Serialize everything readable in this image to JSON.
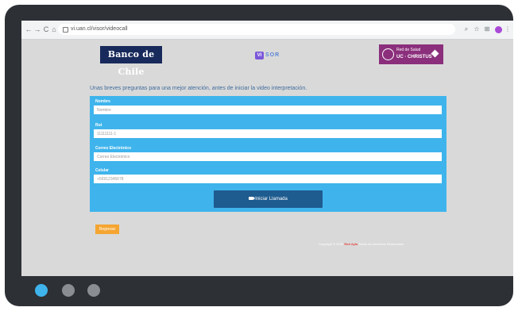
{
  "browser": {
    "url": "vi.uan.cl/visor/videocall",
    "back_glyph": "←",
    "forward_glyph": "→",
    "reload_glyph": "C",
    "home_glyph": "⌂",
    "icons": [
      "search-icon",
      "star-icon",
      "extensions-icon",
      "profile-avatar",
      "menu-icon"
    ]
  },
  "header": {
    "bank_logo_text": "Banco de Chile",
    "visor_mark": "VI",
    "visor_text": "SOR",
    "uc_line1": "Red de Salud",
    "uc_line2": "UC · CHRISTUS"
  },
  "form": {
    "intro": "Unas breves preguntas para una mejor atención, antes de iniciar la video interpretación.",
    "fields": [
      {
        "label": "Nombre",
        "placeholder": "Nombre"
      },
      {
        "label": "Rut",
        "placeholder": "11111111-1"
      },
      {
        "label": "Correo Electrónico",
        "placeholder": "Correo Electrónico"
      },
      {
        "label": "Celular",
        "placeholder": "+56912345678"
      }
    ],
    "call_button": "Iniciar Llamada"
  },
  "back_button": "Regresar",
  "footer": {
    "prefix": "Copyright © 2020",
    "brand": "Red Ayla",
    "suffix": "Todos los derechos Reservados"
  },
  "colors": {
    "panel": "#3fb4ec",
    "call_button": "#1e5b8f",
    "back_button": "#f5a531",
    "dot_active": "#3fb4ec",
    "dot_inactive": "#8a8d91"
  }
}
